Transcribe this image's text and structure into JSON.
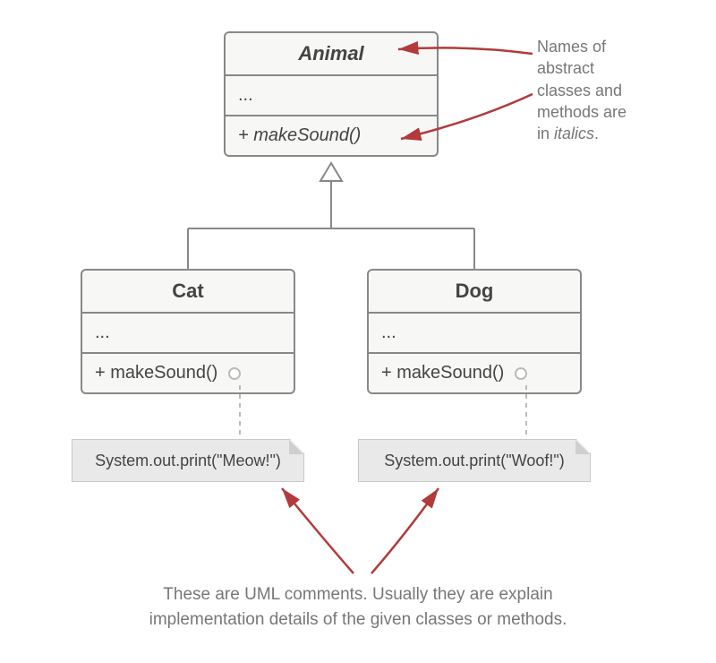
{
  "diagram": {
    "classes": {
      "animal": {
        "name": "Animal",
        "italic": true,
        "attrs": "...",
        "method": "+ makeSound()",
        "method_italic": true
      },
      "cat": {
        "name": "Cat",
        "attrs": "...",
        "method": "+ makeSound()"
      },
      "dog": {
        "name": "Dog",
        "attrs": "...",
        "method": "+ makeSound()"
      }
    },
    "notes": {
      "cat": "System.out.print(\"Meow!\")",
      "dog": "System.out.print(\"Woof!\")"
    },
    "annotations": {
      "abstract_note_line1": "Names of",
      "abstract_note_line2": "abstract",
      "abstract_note_line3": "classes and",
      "abstract_note_line4": "methods are",
      "abstract_note_line5": "in ",
      "abstract_note_italic": "italics",
      "abstract_note_line5_end": ".",
      "comment_note_line1": "These are UML comments. Usually they are explain",
      "comment_note_line2": "implementation details of the given classes or methods."
    }
  },
  "colors": {
    "arrow_red": "#b23a3a",
    "line_gray": "#888888",
    "dash_gray": "#bbbbbb"
  }
}
